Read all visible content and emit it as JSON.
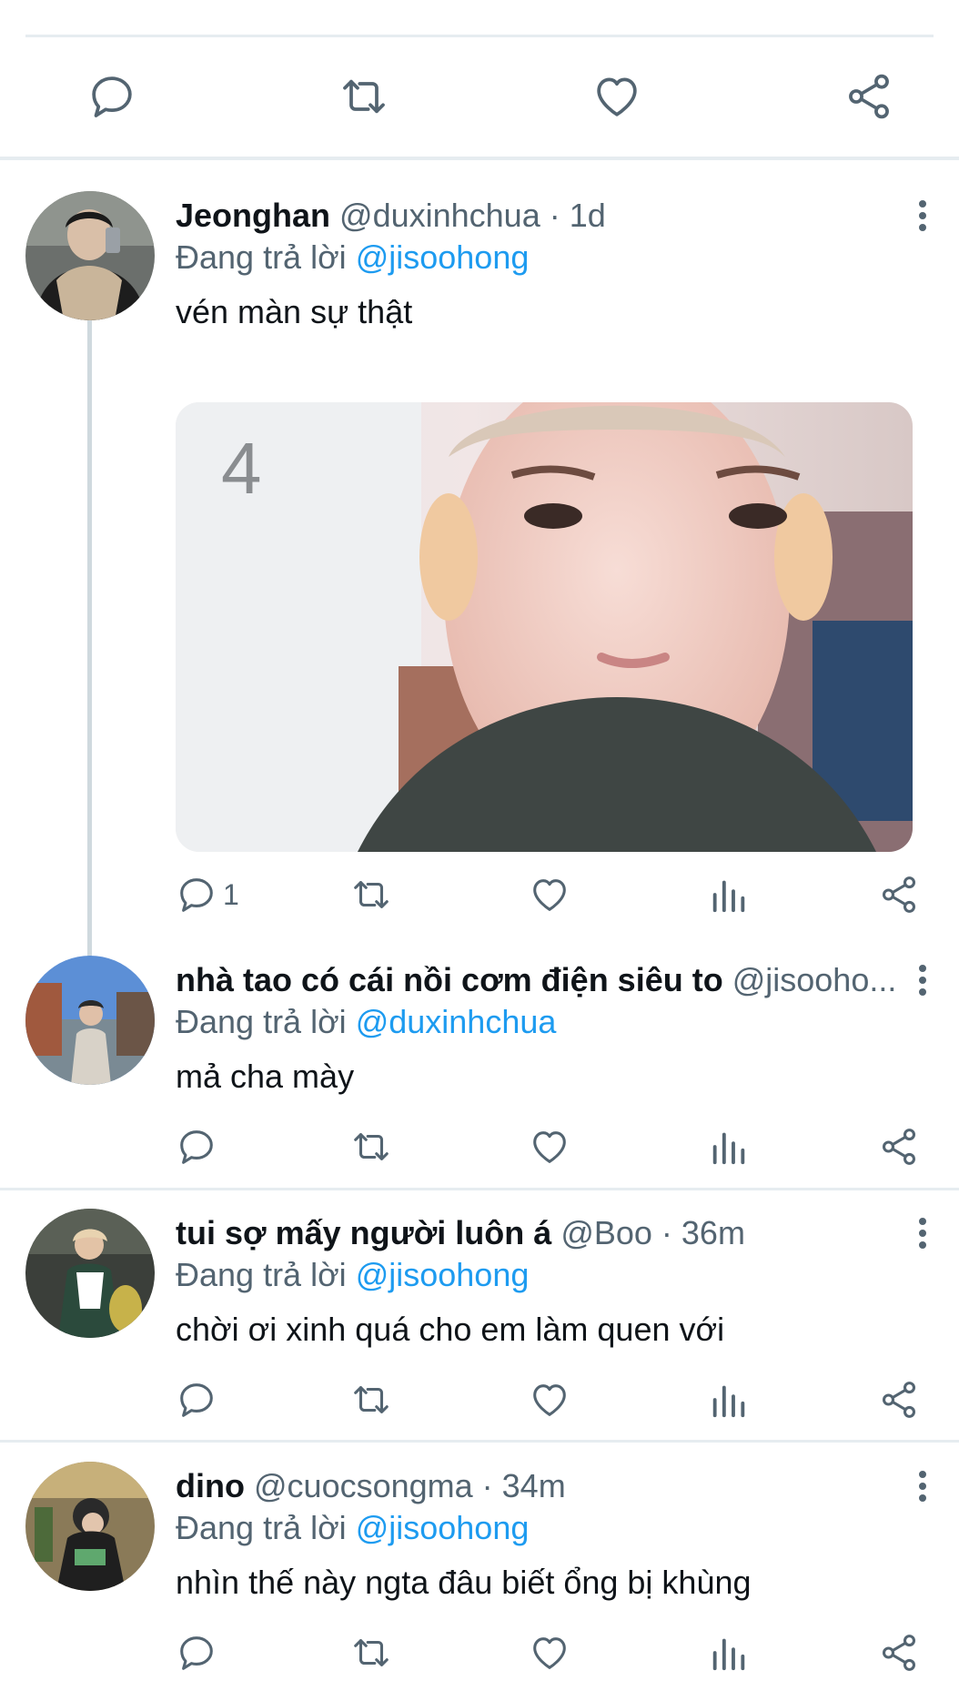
{
  "tweets": [
    {
      "name": "Jeonghan",
      "handle": "@duxinhchua · 1d",
      "reply_prefix": "Đang trả lời",
      "reply_to": "@jisoohong",
      "text": "vén màn sự thật",
      "reply_count": "1"
    },
    {
      "name": "nhà tao có cái nồi cơm điện siêu to",
      "handle": "@jisooho...",
      "reply_prefix": "Đang trả lời",
      "reply_to": "@duxinhchua",
      "text": "mả cha mày",
      "reply_count": ""
    },
    {
      "name": "tui sợ mấy người luôn á",
      "handle": "@Boo · 36m",
      "reply_prefix": "Đang trả lời",
      "reply_to": "@jisoohong",
      "text": "chời ơi xinh quá cho em làm quen với",
      "reply_count": ""
    },
    {
      "name": "dino",
      "handle": "@cuocsongma · 34m",
      "reply_prefix": "Đang trả lời",
      "reply_to": "@jisoohong",
      "text": "nhìn thế này ngta đâu biết ổng bị khùng",
      "reply_count": ""
    }
  ],
  "icons": {
    "reply": "reply-icon",
    "retweet": "retweet-icon",
    "like": "heart-icon",
    "analytics": "analytics-icon",
    "share": "share-icon",
    "menu": "more-vertical-icon"
  },
  "colors": {
    "link": "#1d9bf0",
    "secondary_text": "#536471",
    "icon": "#536471",
    "divider": "#e6ecf0"
  }
}
